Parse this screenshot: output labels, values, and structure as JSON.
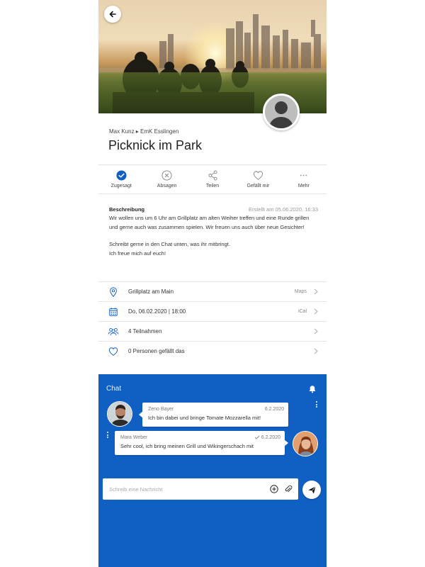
{
  "colors": {
    "accent": "#1060c4",
    "chat_bg": "#1060c4",
    "text": "#333333"
  },
  "header": {
    "back_icon": "arrow-left-icon"
  },
  "event": {
    "meta": "Max Kunz ▸ EmK Esslingen",
    "title": "Picknick im Park"
  },
  "actions": [
    {
      "label": "Zugesagt",
      "icon": "check-circle-icon"
    },
    {
      "label": "Absagen",
      "icon": "x-circle-icon"
    },
    {
      "label": "Teilen",
      "icon": "share-icon"
    },
    {
      "label": "Gefällt mir",
      "icon": "heart-icon"
    },
    {
      "label": "Mehr",
      "icon": "more-icon"
    }
  ],
  "description": {
    "heading": "Beschreibung",
    "created": "Erstellt am 05.06.2020, 16:33",
    "para1": "Wir wollen uns um 6 Uhr am Grillplatz am alten Weiher treffen und eine Runde grillen und gerne auch was zusammen spielen. Wir freuen uns auch über neue Gesichter!",
    "para2a": "Schreibt gerne in den Chat unten, was ihr mitbringt.",
    "para2b": "Ich freue mich auf euch!"
  },
  "details": [
    {
      "text": "Grillplatz am Main",
      "side": "Maps",
      "icon": "location-pin-icon"
    },
    {
      "text": "Do, 06.02.2020 | 18:00",
      "side": "iCal",
      "icon": "calendar-icon"
    },
    {
      "text": "4 Teilnahmen",
      "side": "",
      "icon": "people-icon"
    },
    {
      "text": "0 Personen gefällt das",
      "side": "",
      "icon": "heart-outline-icon"
    }
  ],
  "chat": {
    "title": "Chat",
    "messages": [
      {
        "name": "Zeno Bayer",
        "date": "6.2.2020",
        "text": "Ich bin dabei und bringe Tomate Mozzarella mit!"
      },
      {
        "name": "Mara Weber",
        "date": "6.2.2020",
        "text": "Sehr cool, ich bring meinen Grill und Wikingerschach mit"
      }
    ],
    "input_placeholder": "Schreib eine Nachricht"
  }
}
